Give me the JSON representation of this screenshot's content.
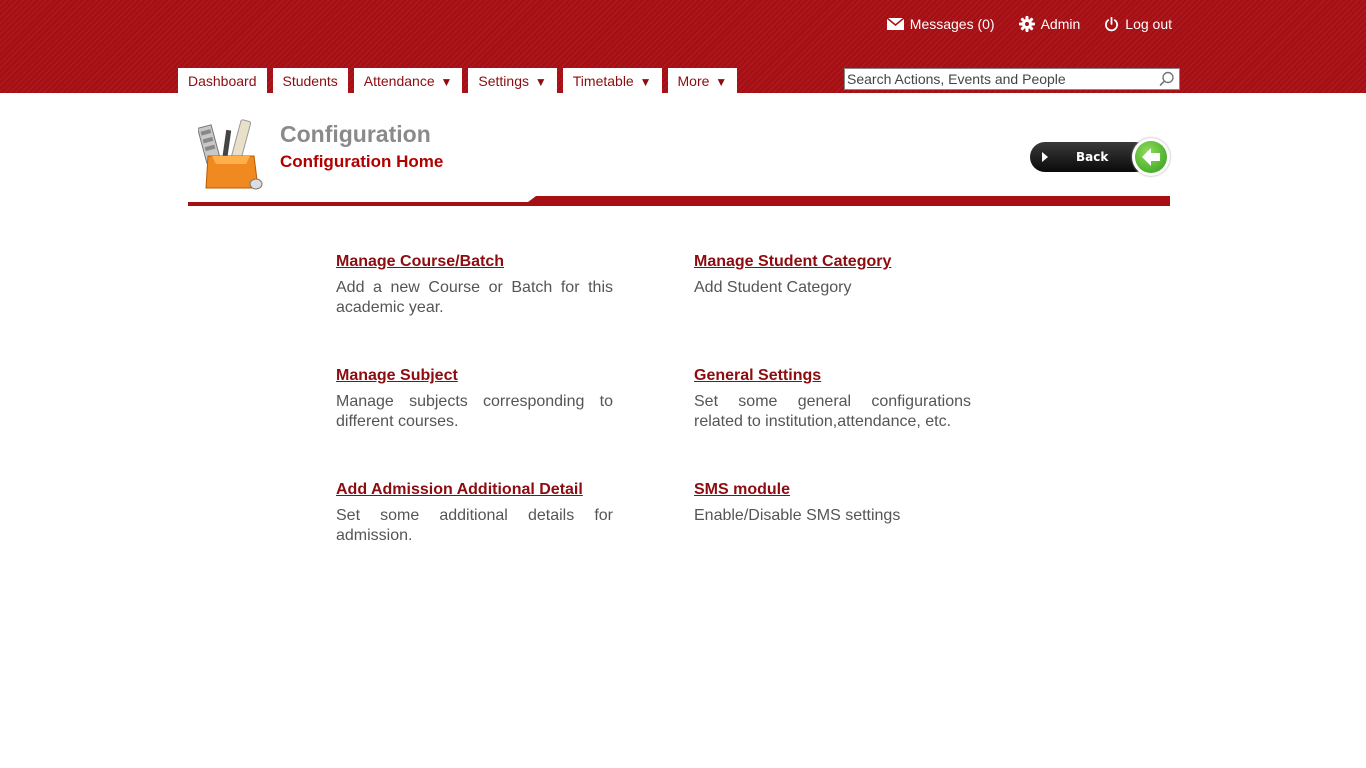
{
  "header": {
    "messages_label": "Messages (0)",
    "admin_label": "Admin",
    "logout_label": "Log out",
    "search_placeholder": "Search Actions, Events and People"
  },
  "nav": {
    "tabs": [
      {
        "label": "Dashboard",
        "caret": ""
      },
      {
        "label": "Students",
        "caret": ""
      },
      {
        "label": "Attendance",
        "caret": "▼"
      },
      {
        "label": "Settings",
        "caret": "▼"
      },
      {
        "label": "Timetable",
        "caret": "▼"
      },
      {
        "label": "More",
        "caret": "▼"
      }
    ]
  },
  "page": {
    "title": "Configuration",
    "subtitle": "Configuration Home",
    "back_label": "Back"
  },
  "items": [
    {
      "title": "Manage Course/Batch",
      "desc": "Add a new Course or Batch for this academic year."
    },
    {
      "title": "Manage Student Category",
      "desc": "Add Student Category"
    },
    {
      "title": "Manage Subject",
      "desc": "Manage subjects corresponding to different courses."
    },
    {
      "title": "General Settings",
      "desc": "Set some general configurations related to institution,attendance, etc."
    },
    {
      "title": "Add Admission Additional Detail",
      "desc": "Set some additional details for admission."
    },
    {
      "title": "SMS module",
      "desc": "Enable/Disable SMS settings"
    }
  ],
  "colors": {
    "brand": "#a60f14",
    "link": "#8c0c10",
    "subtitle": "#b00000"
  },
  "icons": [
    "envelope-icon",
    "gear-icon",
    "power-icon",
    "search-icon",
    "configuration-toolbox-icon",
    "back-arrow-icon"
  ]
}
